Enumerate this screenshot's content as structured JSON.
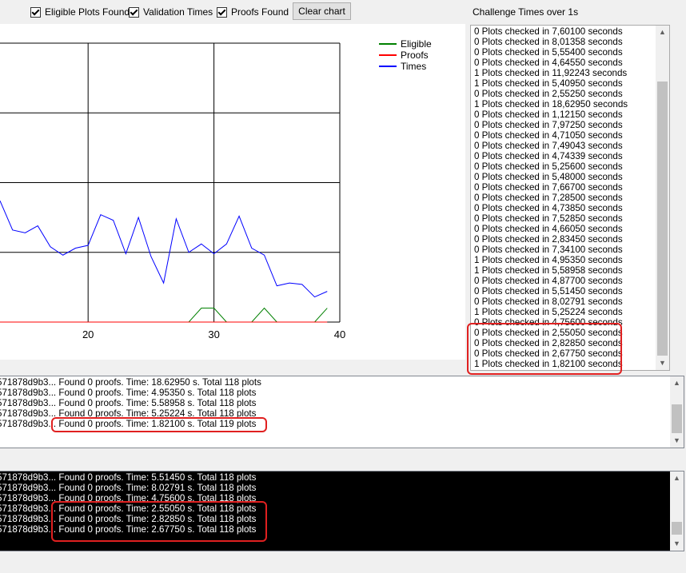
{
  "toolbar": {
    "cb_eligible": "Eligible Plots Found",
    "cb_validation": "Validation Times",
    "cb_proofs": "Proofs Found",
    "clear_chart": "Clear chart"
  },
  "chart_data": {
    "type": "line",
    "x_ticks": [
      "20",
      "30",
      "40"
    ],
    "xlim": [
      13,
      40
    ],
    "ylim": [
      0,
      20
    ],
    "legend": [
      "Eligible",
      "Proofs",
      "Times"
    ],
    "colors": {
      "Eligible": "#008000",
      "Proofs": "#ff0000",
      "Times": "#0000ff"
    },
    "series": [
      {
        "name": "Times",
        "x": [
          13,
          14,
          15,
          16,
          17,
          18,
          19,
          20,
          21,
          22,
          23,
          24,
          25,
          26,
          27,
          28,
          29,
          30,
          31,
          32,
          33,
          34,
          35,
          36,
          37,
          38,
          39
        ],
        "y": [
          8.7,
          6.6,
          6.4,
          6.9,
          5.4,
          4.8,
          5.3,
          5.5,
          7.7,
          7.3,
          4.9,
          7.5,
          4.7,
          2.8,
          7.4,
          5.0,
          5.6,
          4.9,
          5.6,
          7.6,
          5.3,
          4.8,
          2.6,
          2.8,
          2.7,
          1.8,
          2.2
        ]
      },
      {
        "name": "Eligible",
        "x": [
          13,
          14,
          15,
          16,
          17,
          18,
          19,
          20,
          21,
          22,
          23,
          24,
          25,
          26,
          27,
          28,
          29,
          30,
          31,
          32,
          33,
          34,
          35,
          36,
          37,
          38,
          39
        ],
        "y": [
          0,
          0,
          0,
          0,
          0,
          0,
          0,
          0,
          0,
          0,
          0,
          0,
          0,
          0,
          0,
          0,
          1,
          1,
          0,
          0,
          0,
          1,
          0,
          0,
          0,
          0,
          1
        ]
      },
      {
        "name": "Proofs",
        "x": [
          13,
          39
        ],
        "y": [
          0,
          0
        ]
      }
    ]
  },
  "list": {
    "title": "Challenge Times over 1s",
    "items": [
      "0 Plots checked in 7,60100 seconds",
      "0 Plots checked in 8,01358 seconds",
      "0 Plots checked in 5,55400 seconds",
      "0 Plots checked in 4,64550 seconds",
      "1 Plots checked in 11,92243 seconds",
      "1 Plots checked in 5,40950 seconds",
      "0 Plots checked in 2,55250 seconds",
      "1 Plots checked in 18,62950 seconds",
      "0 Plots checked in 1,12150 seconds",
      "0 Plots checked in 7,97250 seconds",
      "0 Plots checked in 4,71050 seconds",
      "0 Plots checked in 7,49043 seconds",
      "0 Plots checked in 4,74339 seconds",
      "0 Plots checked in 5,25600 seconds",
      "0 Plots checked in 5,48000 seconds",
      "0 Plots checked in 7,66700 seconds",
      "0 Plots checked in 7,28500 seconds",
      "0 Plots checked in 4,73850 seconds",
      "0 Plots checked in 7,52850 seconds",
      "0 Plots checked in 4,66050 seconds",
      "0 Plots checked in 2,83450 seconds",
      "0 Plots checked in 7,34100 seconds",
      "1 Plots checked in 4,95350 seconds",
      "1 Plots checked in 5,58958 seconds",
      "0 Plots checked in 4,87700 seconds",
      "0 Plots checked in 5,51450 seconds",
      "0 Plots checked in 8,02791 seconds",
      "1 Plots checked in 5,25224 seconds",
      "0 Plots checked in 4,75600 seconds",
      "0 Plots checked in 2,55050 seconds",
      "0 Plots checked in 2,82850 seconds",
      "0 Plots checked in 2,67750 seconds",
      "1 Plots checked in 1,82100 seconds"
    ]
  },
  "log1": {
    "lines": [
      {
        "prefix": "571878d9b3...",
        "text": "Found 0 proofs. Time: 18.62950 s. Total 118 plots"
      },
      {
        "prefix": "571878d9b3...",
        "text": "Found 0 proofs. Time: 4.95350 s. Total 118 plots"
      },
      {
        "prefix": "571878d9b3...",
        "text": "Found 0 proofs. Time: 5.58958 s. Total 118 plots"
      },
      {
        "prefix": "571878d9b3...",
        "text": "Found 0 proofs. Time: 5.25224 s. Total 118 plots"
      },
      {
        "prefix": "571878d9b3...",
        "text": "Found 0 proofs. Time: 1.82100 s. Total 119 plots"
      }
    ]
  },
  "log2": {
    "lines": [
      {
        "prefix": "571878d9b3...",
        "text": "Found 0 proofs. Time: 5.51450 s. Total 118 plots"
      },
      {
        "prefix": "571878d9b3...",
        "text": "Found 0 proofs. Time: 8.02791 s. Total 118 plots"
      },
      {
        "prefix": "571878d9b3...",
        "text": "Found 0 proofs. Time: 4.75600 s. Total 118 plots"
      },
      {
        "prefix": "571878d9b3...",
        "text": "Found 0 proofs. Time: 2.55050 s. Total 118 plots"
      },
      {
        "prefix": "571878d9b3...",
        "text": "Found 0 proofs. Time: 2.82850 s. Total 118 plots"
      },
      {
        "prefix": "571878d9b3...",
        "text": "Found 0 proofs. Time: 2.67750 s. Total 118 plots"
      }
    ]
  }
}
